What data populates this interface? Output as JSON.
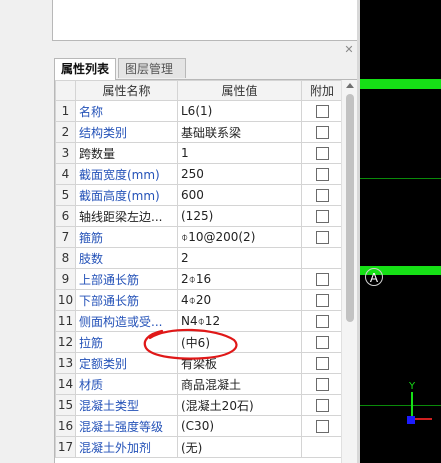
{
  "tabs": [
    "属性列表",
    "图层管理"
  ],
  "close_icon": "close-icon",
  "columns": {
    "index": "",
    "name": "属性名称",
    "value": "属性值",
    "attach": "附加"
  },
  "rows": [
    {
      "no": "1",
      "name": "名称",
      "value": "L6(1)",
      "blue": true,
      "checkbox": true
    },
    {
      "no": "2",
      "name": "结构类别",
      "value": "基础联系梁",
      "blue": true,
      "checkbox": true
    },
    {
      "no": "3",
      "name": "跨数量",
      "value": "1",
      "blue": false,
      "checkbox": true
    },
    {
      "no": "4",
      "name": "截面宽度(mm)",
      "value": "250",
      "blue": true,
      "checkbox": true
    },
    {
      "no": "5",
      "name": "截面高度(mm)",
      "value": "600",
      "blue": true,
      "checkbox": true
    },
    {
      "no": "6",
      "name": "轴线距梁左边...",
      "value": "(125)",
      "blue": false,
      "checkbox": true
    },
    {
      "no": "7",
      "name": "箍筋",
      "value": "⌽10@200(2)",
      "blue": true,
      "checkbox": true
    },
    {
      "no": "8",
      "name": "肢数",
      "value": "2",
      "blue": true,
      "checkbox": false
    },
    {
      "no": "9",
      "name": "上部通长筋",
      "value": "2⌽16",
      "blue": true,
      "checkbox": true
    },
    {
      "no": "10",
      "name": "下部通长筋",
      "value": "4⌽20",
      "blue": true,
      "checkbox": true
    },
    {
      "no": "11",
      "name": "侧面构造或受...",
      "value": "N4⌽12",
      "blue": true,
      "checkbox": true
    },
    {
      "no": "12",
      "name": "拉筋",
      "value": "(中6)",
      "blue": true,
      "checkbox": true
    },
    {
      "no": "13",
      "name": "定额类别",
      "value": "有梁板",
      "blue": true,
      "checkbox": true
    },
    {
      "no": "14",
      "name": "材质",
      "value": "商品混凝土",
      "blue": true,
      "checkbox": true
    },
    {
      "no": "15",
      "name": "混凝土类型",
      "value": "(混凝土20石)",
      "blue": true,
      "checkbox": true
    },
    {
      "no": "16",
      "name": "混凝土强度等级",
      "value": "(C30)",
      "blue": true,
      "checkbox": true
    },
    {
      "no": "17",
      "name": "混凝土外加剂",
      "value": "(无)",
      "blue": true,
      "checkbox": false
    }
  ],
  "canvas": {
    "axis_label": "A",
    "ucs_y": "Y"
  },
  "colors": {
    "link_blue": "#2452b8",
    "beam_green": "#16e016",
    "annotation_red": "#e01818"
  }
}
